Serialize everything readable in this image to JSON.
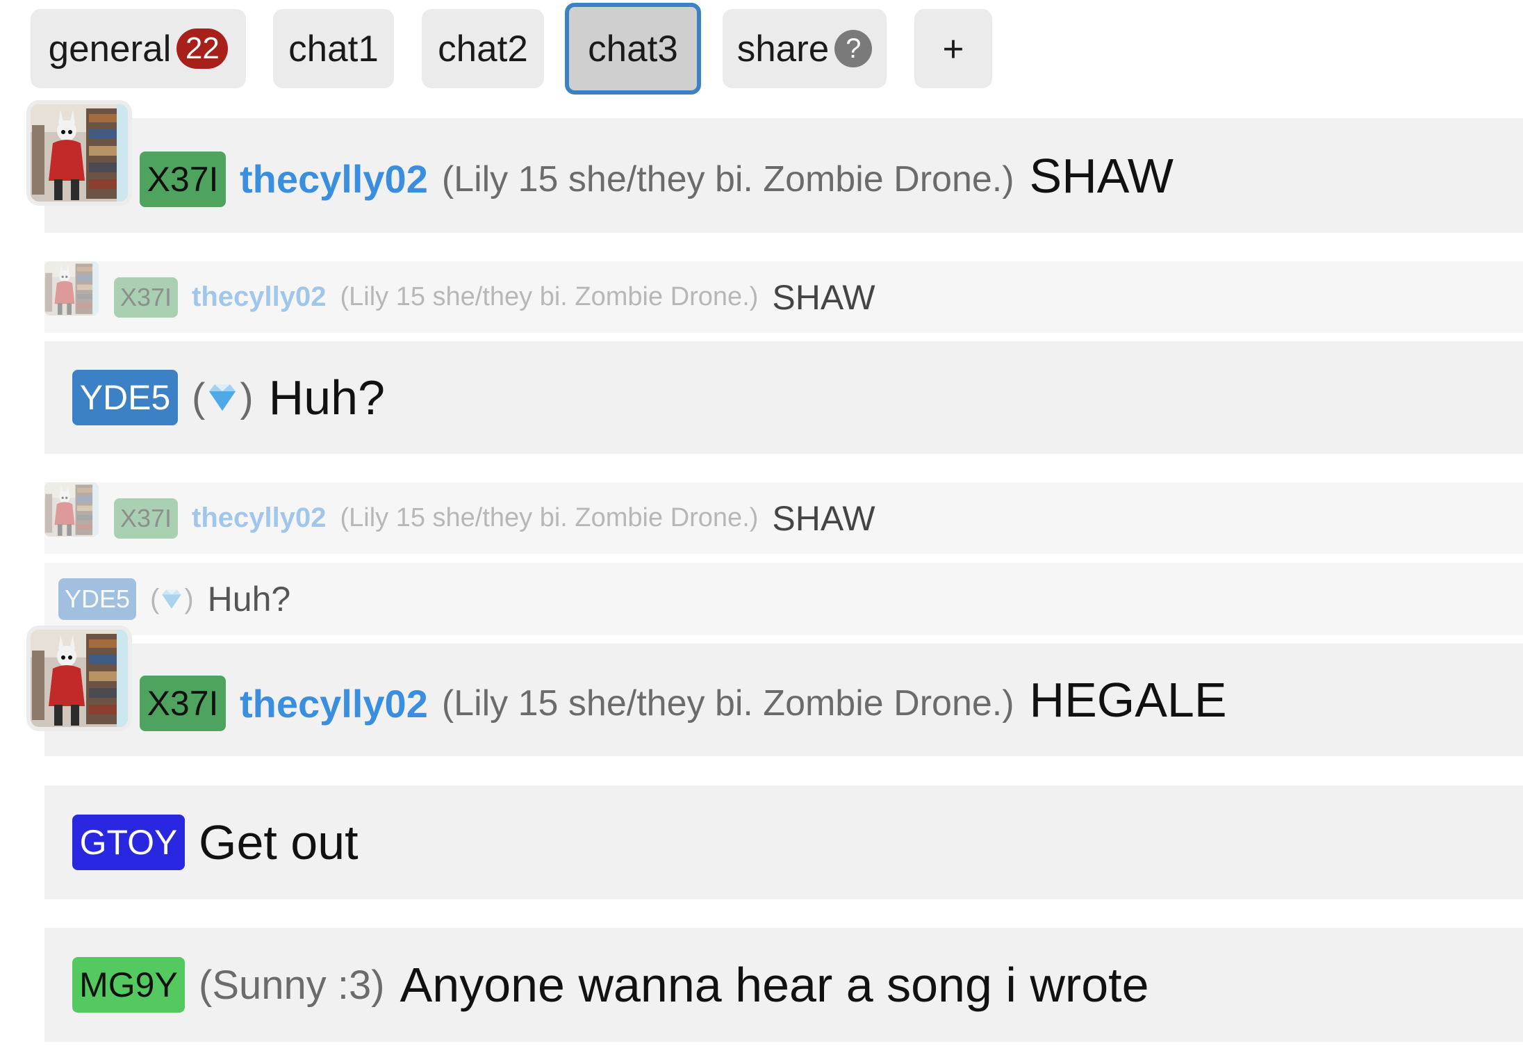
{
  "tabs": [
    {
      "label": "general",
      "badge": "22"
    },
    {
      "label": "chat1"
    },
    {
      "label": "chat2"
    },
    {
      "label": "chat3",
      "active": true
    },
    {
      "label": "share",
      "help": "?"
    },
    {
      "label": "+"
    }
  ],
  "colors": {
    "badge_green": "#4ea45f",
    "badge_blue": "#3c81c6",
    "badge_indigo": "#2a27e0",
    "badge_lime": "#53c95f",
    "username": "#3a8ee0",
    "tab_active_border": "#3b82c4"
  },
  "messages": [
    {
      "id": "X37I",
      "user": "thecylly02",
      "bio": "(Lily 15 she/they bi. Zombie Drone.)",
      "text": "SHAW",
      "avatar": "avatar-photo"
    },
    {
      "reply": {
        "id": "X37I",
        "user": "thecylly02",
        "bio": "(Lily 15 she/they bi. Zombie Drone.)",
        "text": "SHAW"
      },
      "id": "YDE5",
      "paren_open": "(",
      "paren_close": ")",
      "icon": "gem-icon",
      "text": "Huh?"
    },
    {
      "reply": {
        "id": "X37I",
        "user": "thecylly02",
        "bio": "(Lily 15 she/they bi. Zombie Drone.)",
        "text": "SHAW"
      },
      "reply2": {
        "id": "YDE5",
        "paren_open": "(",
        "paren_close": ")",
        "icon": "gem-icon",
        "text": "Huh?"
      }
    },
    {
      "id": "X37I",
      "user": "thecylly02",
      "bio": "(Lily 15 she/they bi. Zombie Drone.)",
      "text": "HEGALE",
      "avatar": "avatar-photo"
    },
    {
      "id": "GTOY",
      "text": "Get out"
    },
    {
      "id": "MG9Y",
      "bio": "(Sunny :3)",
      "text": "Anyone wanna hear a song i wrote"
    }
  ]
}
